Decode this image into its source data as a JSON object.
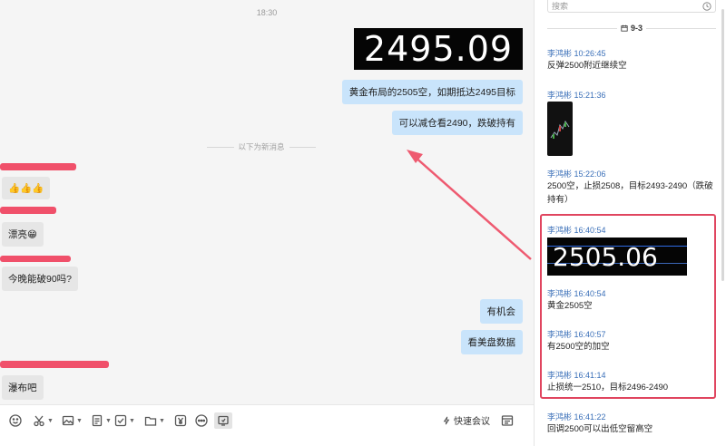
{
  "chat": {
    "time": "18:30",
    "price_image_value": "2495.09",
    "my_messages": [
      "黄金布局的2505空，如期抵达2495目标",
      "可以减仓看2490，跌破持有",
      "有机会",
      "看美盘数据"
    ],
    "new_message_divider": "以下为新消息",
    "other_messages": [
      "👍👍👍",
      "漂亮😁",
      "今晚能破90吗?",
      "瀑布吧"
    ]
  },
  "toolbar": {
    "icons": [
      "emoji-icon",
      "scissors-icon",
      "image-icon",
      "document-icon",
      "checkbox-icon",
      "folder-icon",
      "yen-icon",
      "more-icon",
      "screen-share-icon"
    ],
    "quick_meeting_label": "快速会议"
  },
  "history": {
    "search_placeholder": "搜索",
    "date_label": "9-3",
    "items": [
      {
        "sender_time": "李鸿彬 10:26:45",
        "text": "反弹2500附近继续空"
      },
      {
        "sender_time": "李鸿彬 15:21:36",
        "text": ""
      },
      {
        "sender_time": "李鸿彬 15:22:06",
        "text": "2500空，止损2508，目标2493-2490（跌破持有）"
      },
      {
        "sender_time": "李鸿彬 16:40:54",
        "text": ""
      },
      {
        "sender_time": "李鸿彬 16:40:54",
        "text": "黄金2505空"
      },
      {
        "sender_time": "李鸿彬 16:40:57",
        "text": "有2500空的加空"
      },
      {
        "sender_time": "李鸿彬 16:41:14",
        "text": "止损统一2510，目标2496-2490"
      },
      {
        "sender_time": "李鸿彬 16:41:22",
        "text": "回调2500可以出低空留高空"
      }
    ],
    "price_image_value": "2505.06"
  },
  "colors": {
    "accent_red": "#e0455f",
    "my_bubble": "#c9e4fb",
    "sender_blue": "#3a6fb8"
  }
}
